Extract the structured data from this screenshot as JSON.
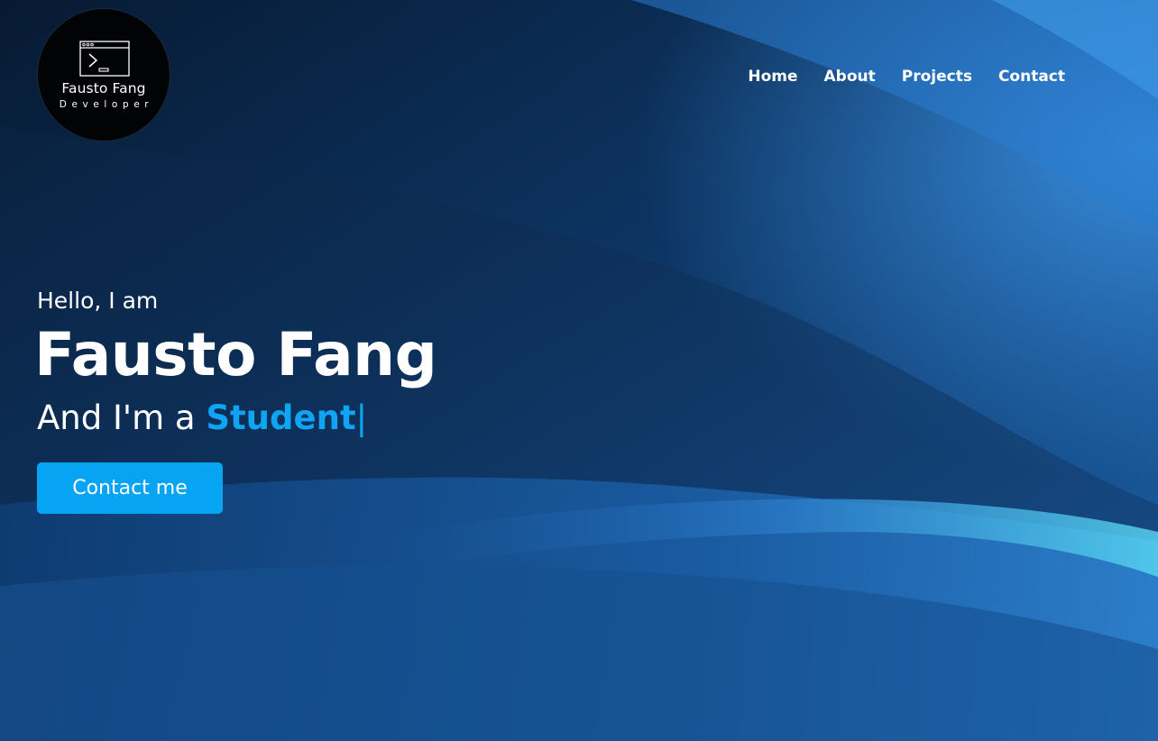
{
  "logo": {
    "icon": "terminal-window-icon",
    "name": "Fausto Fang",
    "role": "Developer"
  },
  "nav": {
    "items": [
      "Home",
      "About",
      "Projects",
      "Contact"
    ]
  },
  "hero": {
    "greeting": "Hello, I am",
    "name": "Fausto Fang",
    "role_prefix": "And I'm a ",
    "role_word": "Student",
    "cursor": "|",
    "cta_label": "Contact me"
  },
  "colors": {
    "accent": "#0ea5f5",
    "button": "#08a4f4",
    "logo_bg": "#020305",
    "background": "#0b2a4e"
  }
}
